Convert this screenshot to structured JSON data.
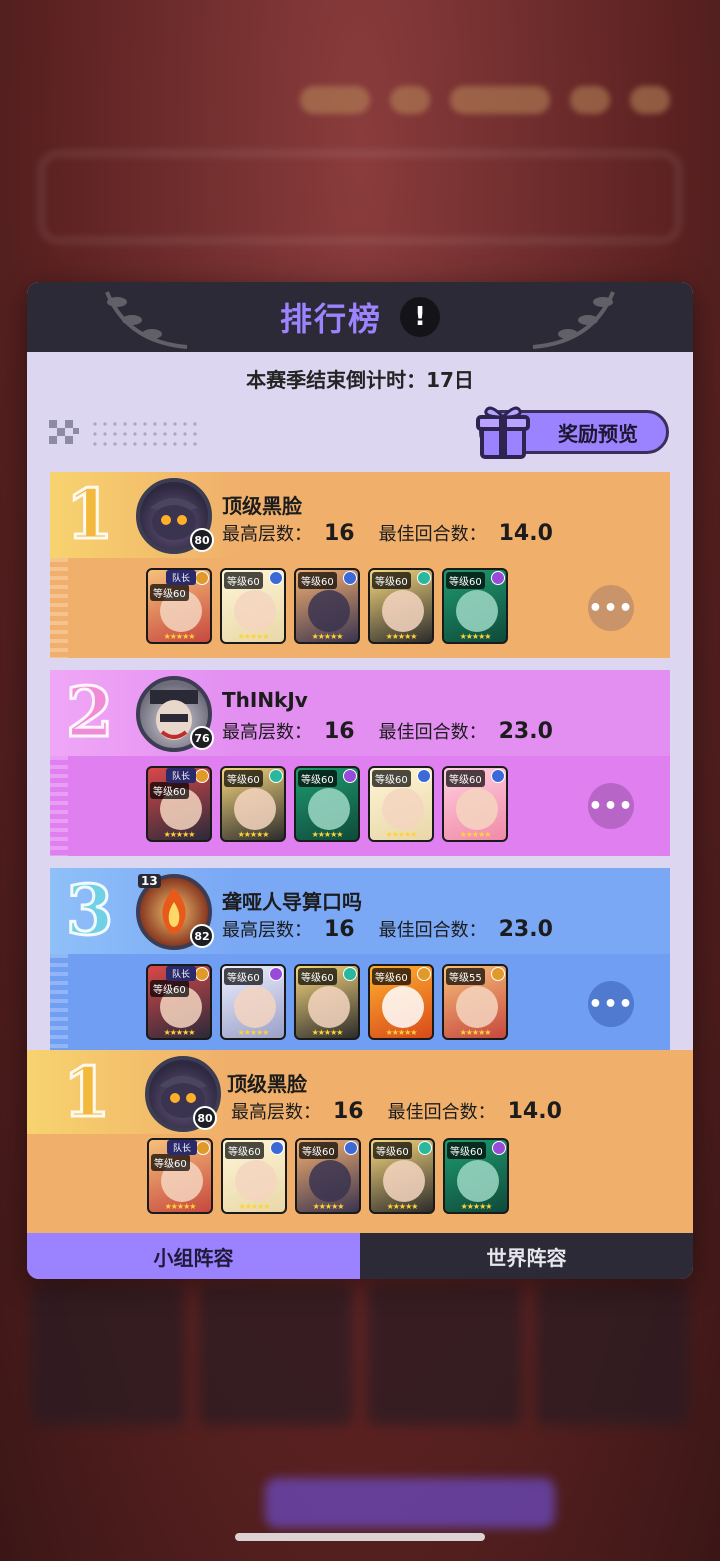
{
  "panel": {
    "title": "排行榜",
    "info_label": "!",
    "countdown": "本赛季结束倒计时：17日",
    "reward_button": "奖励预览"
  },
  "colors": {
    "gold": "#f0b06b",
    "gold_top": "#f7c86e",
    "purple": "#df7ff0",
    "purple_top": "#e38ff2",
    "blue": "#6f9ef2",
    "blue_top": "#7aa8f5",
    "accent": "#9b82ff"
  },
  "entries": [
    {
      "rank": "1",
      "name": "顶级黑脸",
      "level": "80",
      "floor_label": "最高层数：",
      "floor": "16",
      "round_label": "最佳回合数：",
      "round": "14.0",
      "heroes": [
        {
          "lv": "等级60",
          "captain": "队长",
          "element": "#e09a2a"
        },
        {
          "lv": "等级60",
          "element": "#3b6ad8"
        },
        {
          "lv": "等级60",
          "element": "#3b6ad8"
        },
        {
          "lv": "等级60",
          "element": "#2ab7a0"
        },
        {
          "lv": "等级60",
          "element": "#9a4ad8"
        }
      ]
    },
    {
      "rank": "2",
      "name": "ThINkJv",
      "level": "76",
      "floor_label": "最高层数：",
      "floor": "16",
      "round_label": "最佳回合数：",
      "round": "23.0",
      "heroes": [
        {
          "lv": "等级60",
          "captain": "队长",
          "element": "#e09a2a"
        },
        {
          "lv": "等级60",
          "element": "#2ab7a0"
        },
        {
          "lv": "等级60",
          "element": "#9a4ad8"
        },
        {
          "lv": "等级60",
          "element": "#3b6ad8"
        },
        {
          "lv": "等级60",
          "element": "#3b6ad8"
        }
      ]
    },
    {
      "rank": "3",
      "name": "聋哑人导算口吗",
      "level": "82",
      "badge": "13",
      "floor_label": "最高层数：",
      "floor": "16",
      "round_label": "最佳回合数：",
      "round": "23.0",
      "heroes": [
        {
          "lv": "等级60",
          "captain": "队长",
          "element": "#e09a2a"
        },
        {
          "lv": "等级60",
          "element": "#9a4ad8"
        },
        {
          "lv": "等级60",
          "element": "#2ab7a0"
        },
        {
          "lv": "等级60",
          "element": "#e09a2a"
        },
        {
          "lv": "等级55",
          "element": "#e09a2a"
        }
      ]
    }
  ],
  "self_entry": {
    "rank": "1",
    "name": "顶级黑脸",
    "level": "80",
    "floor_label": "最高层数：",
    "floor": "16",
    "round_label": "最佳回合数：",
    "round": "14.0",
    "heroes": [
      {
        "lv": "等级60",
        "captain": "队长",
        "element": "#e09a2a"
      },
      {
        "lv": "等级60",
        "element": "#3b6ad8"
      },
      {
        "lv": "等级60",
        "element": "#3b6ad8"
      },
      {
        "lv": "等级60",
        "element": "#2ab7a0"
      },
      {
        "lv": "等级60",
        "element": "#9a4ad8"
      }
    ]
  },
  "tabs": {
    "group": "小组阵容",
    "world": "世界阵容"
  },
  "icons": {
    "more": "more-dots-icon",
    "gift": "gift-icon",
    "info": "info-icon"
  }
}
